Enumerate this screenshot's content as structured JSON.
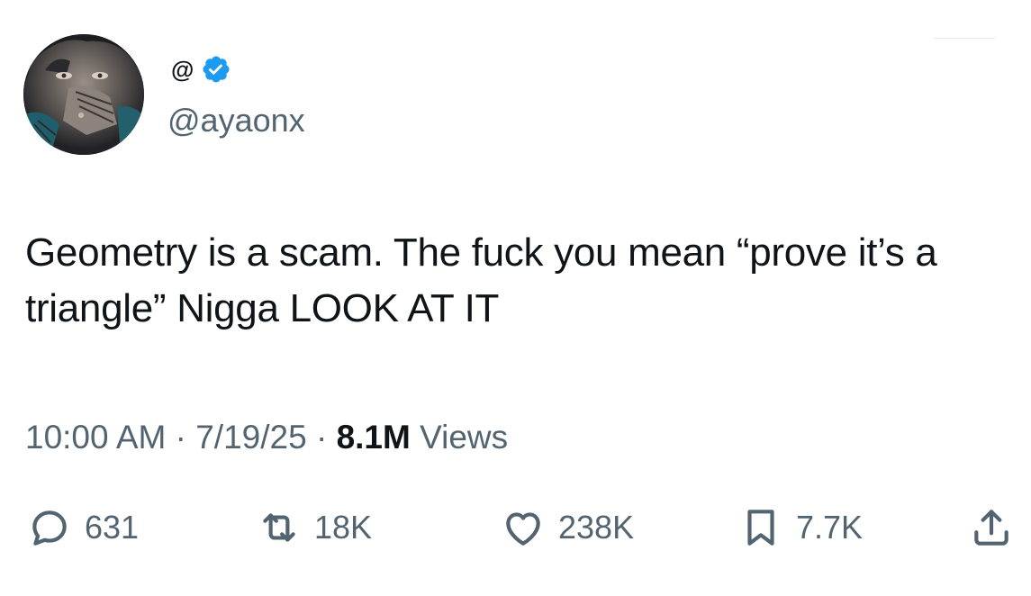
{
  "author": {
    "display_name": "@",
    "handle": "@ayaonx",
    "verified": true
  },
  "tweet": {
    "text": "Geometry is a scam. The fuck you mean “prove it’s a triangle” Nigga LOOK AT IT",
    "time": "10:00 AM",
    "separator": " · ",
    "date": "7/19/25",
    "views_count": "8.1M",
    "views_label": " Views"
  },
  "engagement": {
    "replies": "631",
    "reposts": "18K",
    "likes": "238K",
    "bookmarks": "7.7K"
  },
  "icons": {
    "reply": "reply-icon",
    "repost": "repost-icon",
    "like": "heart-icon",
    "bookmark": "bookmark-icon",
    "share": "share-icon",
    "verified": "verified-badge-icon"
  },
  "colors": {
    "text_primary": "#0f1419",
    "text_secondary": "#536471",
    "verified_blue": "#1d9bf0"
  }
}
